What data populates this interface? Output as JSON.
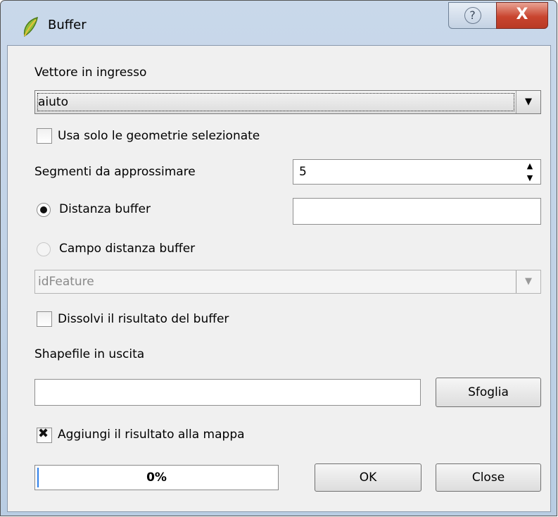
{
  "window": {
    "title": "Buffer",
    "help_glyph": "?",
    "close_glyph": "X",
    "app_icon": "qgis-leaf-icon"
  },
  "input_layer": {
    "label": "Vettore in ingresso",
    "selected": "aiuto"
  },
  "selected_only": {
    "label": "Usa solo le geometrie selezionate",
    "checked": false
  },
  "segments": {
    "label": "Segmenti da approssimare",
    "value": "5"
  },
  "buffer_distance": {
    "label": "Distanza buffer",
    "value": "",
    "selected": true
  },
  "buffer_field": {
    "label": "Campo distanza buffer",
    "selected": false,
    "field": "idFeature"
  },
  "dissolve": {
    "label": "Dissolvi il risultato del buffer",
    "checked": false
  },
  "output": {
    "label": "Shapefile in uscita",
    "value": "",
    "browse_label": "Sfoglia"
  },
  "add_to_map": {
    "label": "Aggiungi il risultato alla mappa",
    "checked": true
  },
  "progress": {
    "text": "0%",
    "value": 0
  },
  "buttons": {
    "ok": "OK",
    "close": "Close"
  },
  "colors": {
    "progress_fill": "#2f7fe8",
    "close_button": "#c9452f"
  }
}
